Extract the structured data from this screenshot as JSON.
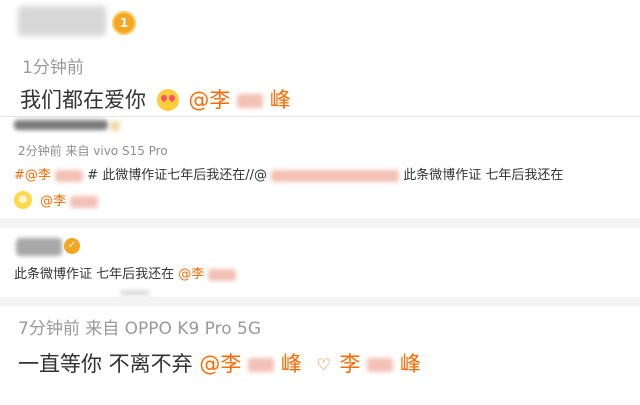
{
  "colors": {
    "text_primary": "#333333",
    "text_meta": "#9a9a9a",
    "mention": "#ff6a00",
    "vip_badge": "#f5a623",
    "separator": "#e6e6e6"
  },
  "post1": {
    "vip_badge_text": "1",
    "time": "1分钟前",
    "text_prefix": "我们都在爱你",
    "emoji_icon": "heart-eyes-emoji",
    "mention_prefix": "@李",
    "mention_suffix": "峰"
  },
  "post2": {
    "meta": "2分钟前  来自 vivo S15 Pro",
    "line1_prefix": "#@李",
    "line1_mid": "# 此微博作证七年后我还在//@",
    "line1_suffix": "此条微博作证 七年后我还在",
    "line2_icon": "face-icon",
    "line2_mention_prefix": "@李"
  },
  "post3": {
    "badge_icon": "verified-check-icon",
    "text_prefix": "此条微博作证 七年后我还在",
    "mention_prefix": "@李"
  },
  "post4": {
    "meta": "7分钟前  来自 OPPO K9 Pro 5G",
    "text_prefix": "一直等你 不离不弃",
    "mention1_prefix": "@李",
    "mention1_suffix": "峰",
    "heart_icon": "♡",
    "mention2_prefix": "李",
    "mention2_suffix": "峰"
  }
}
